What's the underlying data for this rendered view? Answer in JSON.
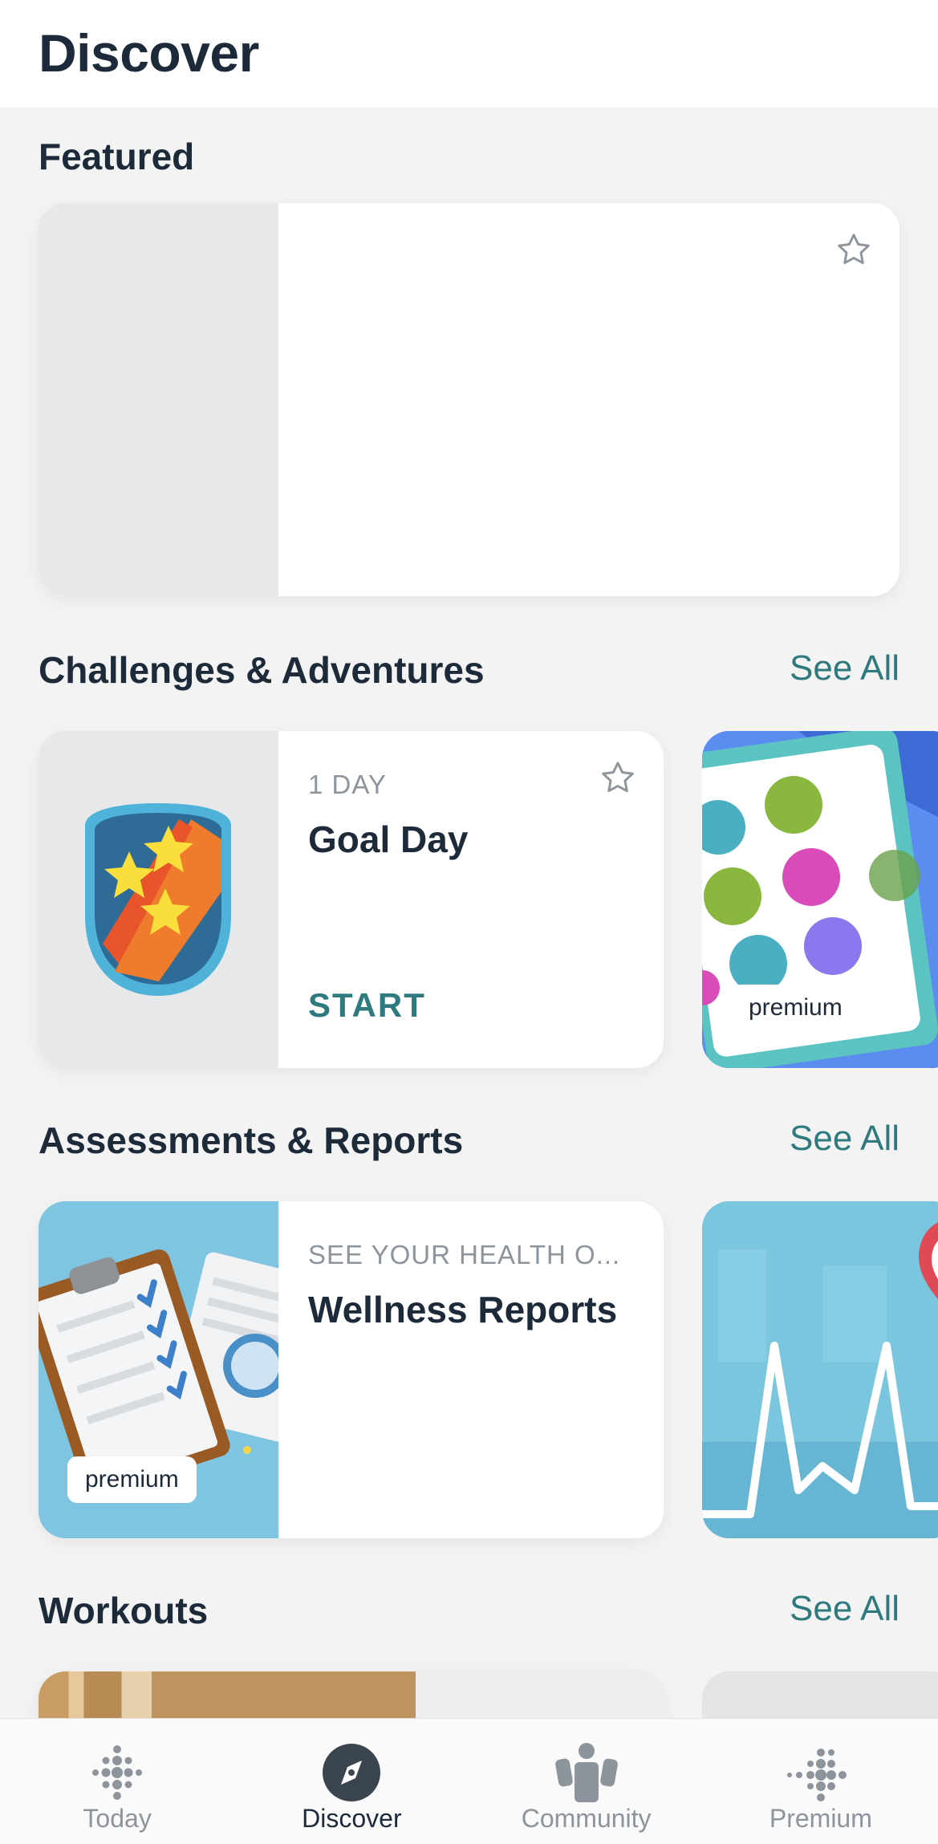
{
  "header": {
    "title": "Discover"
  },
  "featured": {
    "section_title": "Featured"
  },
  "challenges": {
    "section_title": "Challenges & Adventures",
    "see_all": "See All",
    "card": {
      "eyebrow": "1 DAY",
      "title": "Goal Day",
      "action": "START"
    },
    "peek_badge": "premium"
  },
  "assessments": {
    "section_title": "Assessments & Reports",
    "see_all": "See All",
    "card": {
      "eyebrow": "SEE YOUR HEALTH O...",
      "title": "Wellness Reports",
      "badge": "premium"
    }
  },
  "workouts": {
    "section_title": "Workouts",
    "see_all": "See All"
  },
  "bottom_nav": {
    "items": [
      {
        "label": "Today",
        "icon": "fitbit-dots-icon"
      },
      {
        "label": "Discover",
        "icon": "compass-icon"
      },
      {
        "label": "Community",
        "icon": "people-icon"
      },
      {
        "label": "Premium",
        "icon": "premium-dots-icon"
      }
    ],
    "active": "Discover"
  },
  "colors": {
    "accent": "#2f7a7e",
    "text_primary": "#1c2a39",
    "text_secondary": "#8d949b",
    "background": "#f3f3f3"
  }
}
